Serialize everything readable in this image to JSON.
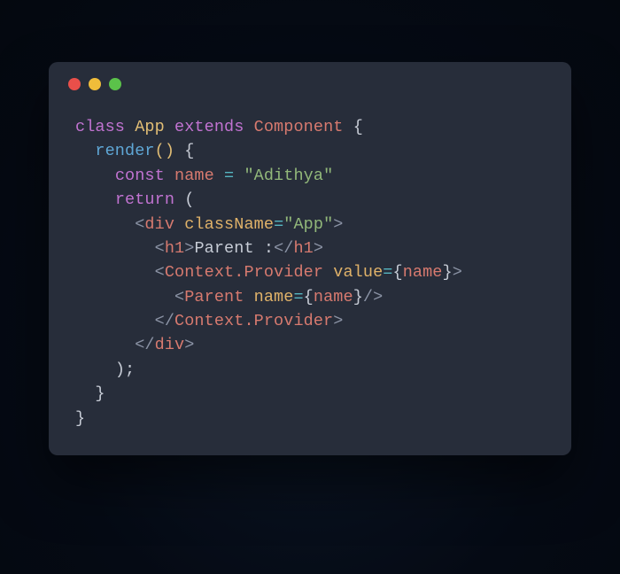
{
  "window": {
    "traffic_lights": {
      "close_color": "#e94f4a",
      "minimize_color": "#f0bd3a",
      "zoom_color": "#5bc24a"
    }
  },
  "code": {
    "kw_class": "class",
    "class_name": "App",
    "kw_extends": "extends",
    "superclass": "Component",
    "brace_open": "{",
    "brace_close": "}",
    "method_name": "render",
    "method_parens": "()",
    "kw_const": "const",
    "var_name": "name",
    "assign_eq": "=",
    "string_value": "\"Adithya\"",
    "kw_return": "return",
    "paren_open": "(",
    "paren_close": ")",
    "semicolon": ";",
    "jsx_lt": "<",
    "jsx_gt": ">",
    "jsx_slash": "/",
    "jsx_eq": "=",
    "tag_div": "div",
    "attr_className": "className",
    "attrv_App": "\"App\"",
    "tag_h1": "h1",
    "h1_text": "Parent :",
    "tag_ContextProvider": "Context.Provider",
    "attr_value": "value",
    "expr_name_open": "{",
    "expr_name_var": "name",
    "expr_name_close": "}",
    "tag_Parent": "Parent",
    "attr_name": "name",
    "indent1": "  ",
    "indent2": "    ",
    "indent3": "      ",
    "indent4": "        ",
    "indent5": "          ",
    "sp": " "
  }
}
